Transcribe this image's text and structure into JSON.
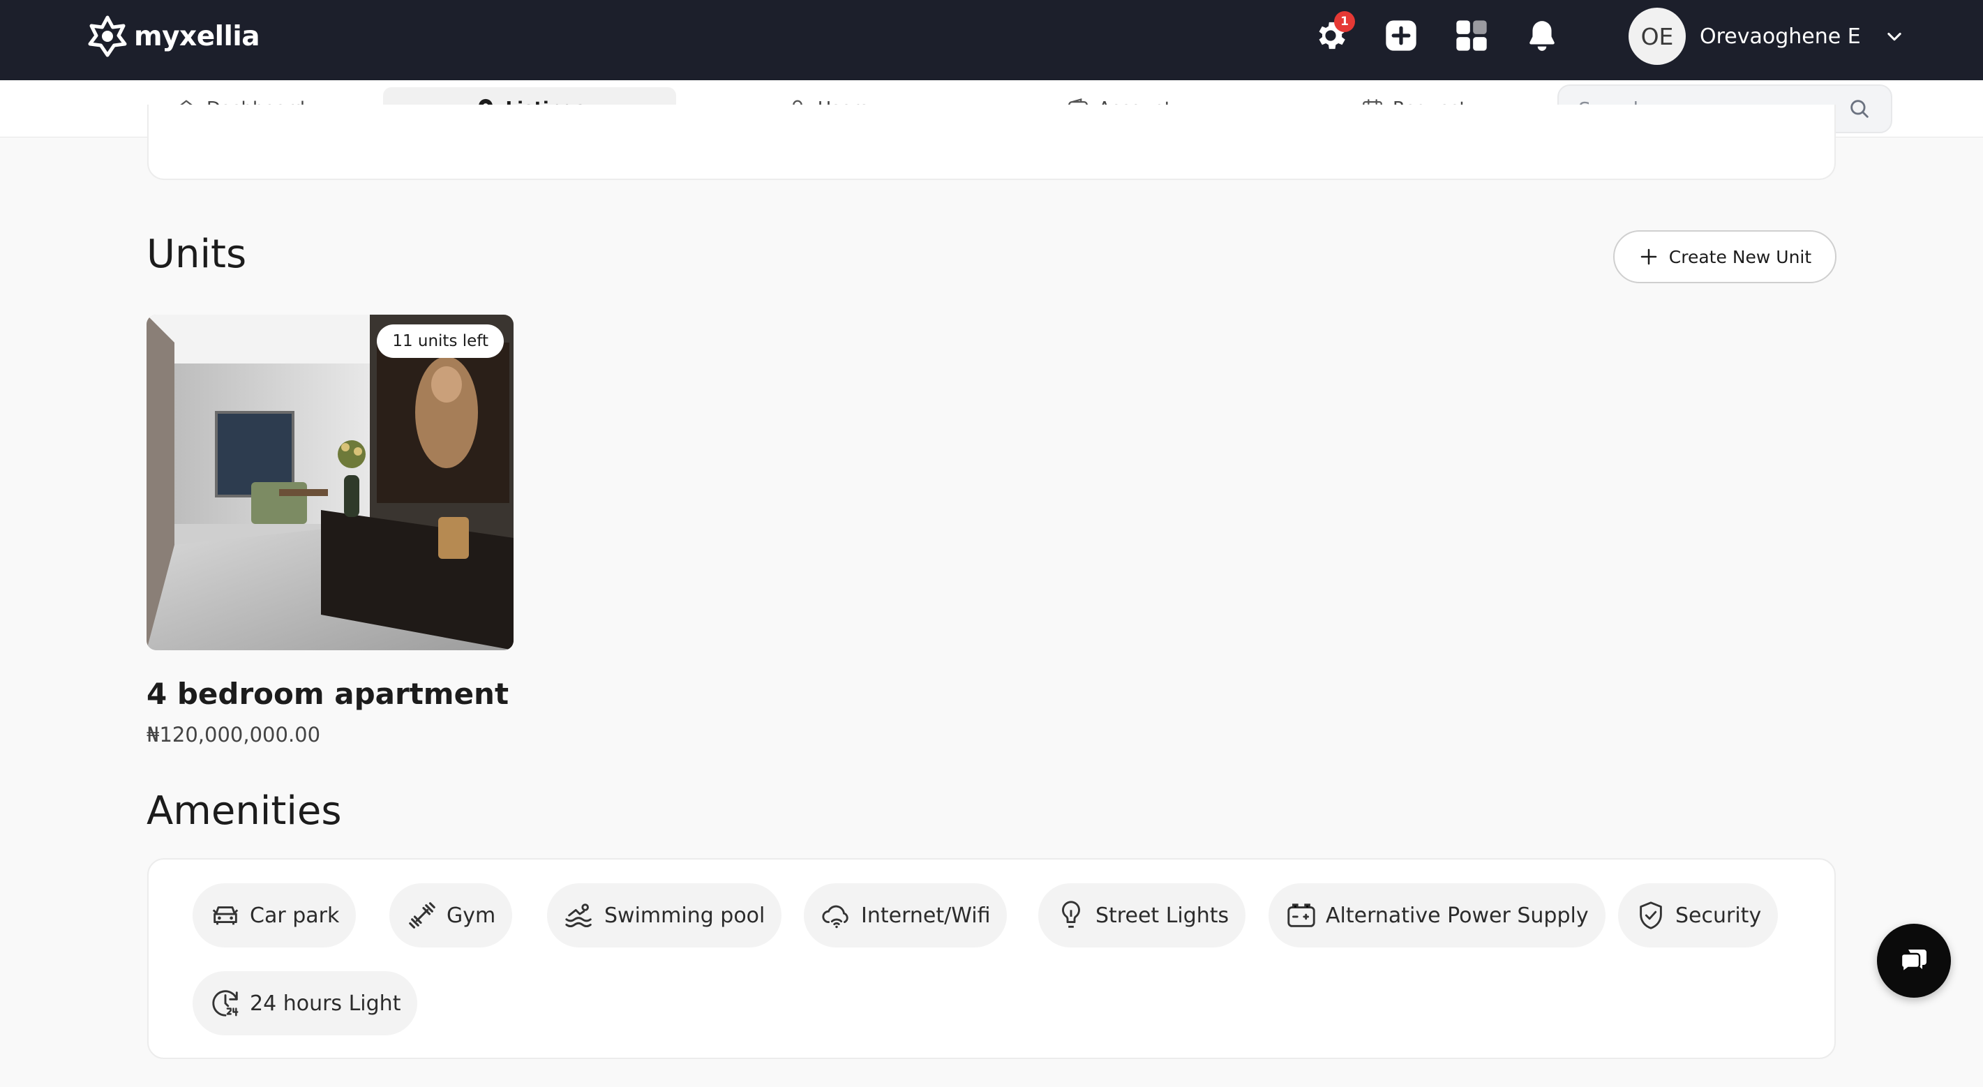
{
  "brand": {
    "name": "myxellia"
  },
  "topbar": {
    "notification_badge": "1",
    "user": {
      "initials": "OE",
      "name": "Orevaoghene E"
    }
  },
  "nav": {
    "items": [
      {
        "label": "Dashboard",
        "icon": "home-icon",
        "active": false
      },
      {
        "label": "Listings",
        "icon": "map-pin-icon",
        "active": true
      },
      {
        "label": "Users",
        "icon": "user-icon",
        "active": false
      },
      {
        "label": "Account",
        "icon": "wallet-icon",
        "active": false
      },
      {
        "label": "Request",
        "icon": "calendar-icon",
        "active": false
      }
    ],
    "search_placeholder": "Search..."
  },
  "units": {
    "title": "Units",
    "create_button": "Create New Unit",
    "cards": [
      {
        "title": "4 bedroom apartment",
        "price": "₦120,000,000.00",
        "badge": "11 units left"
      }
    ]
  },
  "amenities": {
    "title": "Amenities",
    "items": [
      {
        "label": "Car park",
        "icon": "car-icon"
      },
      {
        "label": "Gym",
        "icon": "dumbbell-icon"
      },
      {
        "label": "Swimming pool",
        "icon": "swimming-icon"
      },
      {
        "label": "Internet/Wifi",
        "icon": "cloud-wifi-icon"
      },
      {
        "label": "Street Lights",
        "icon": "lightbulb-icon"
      },
      {
        "label": "Alternative Power Supply",
        "icon": "battery-icon"
      },
      {
        "label": "Security",
        "icon": "shield-check-icon"
      },
      {
        "label": "24 hours Light",
        "icon": "clock-24-icon"
      }
    ]
  },
  "colors": {
    "topbar_bg": "#1c1f2b",
    "page_bg": "#f9f9f9",
    "badge_red": "#e53935",
    "chip_bg": "#f3f3f3"
  }
}
